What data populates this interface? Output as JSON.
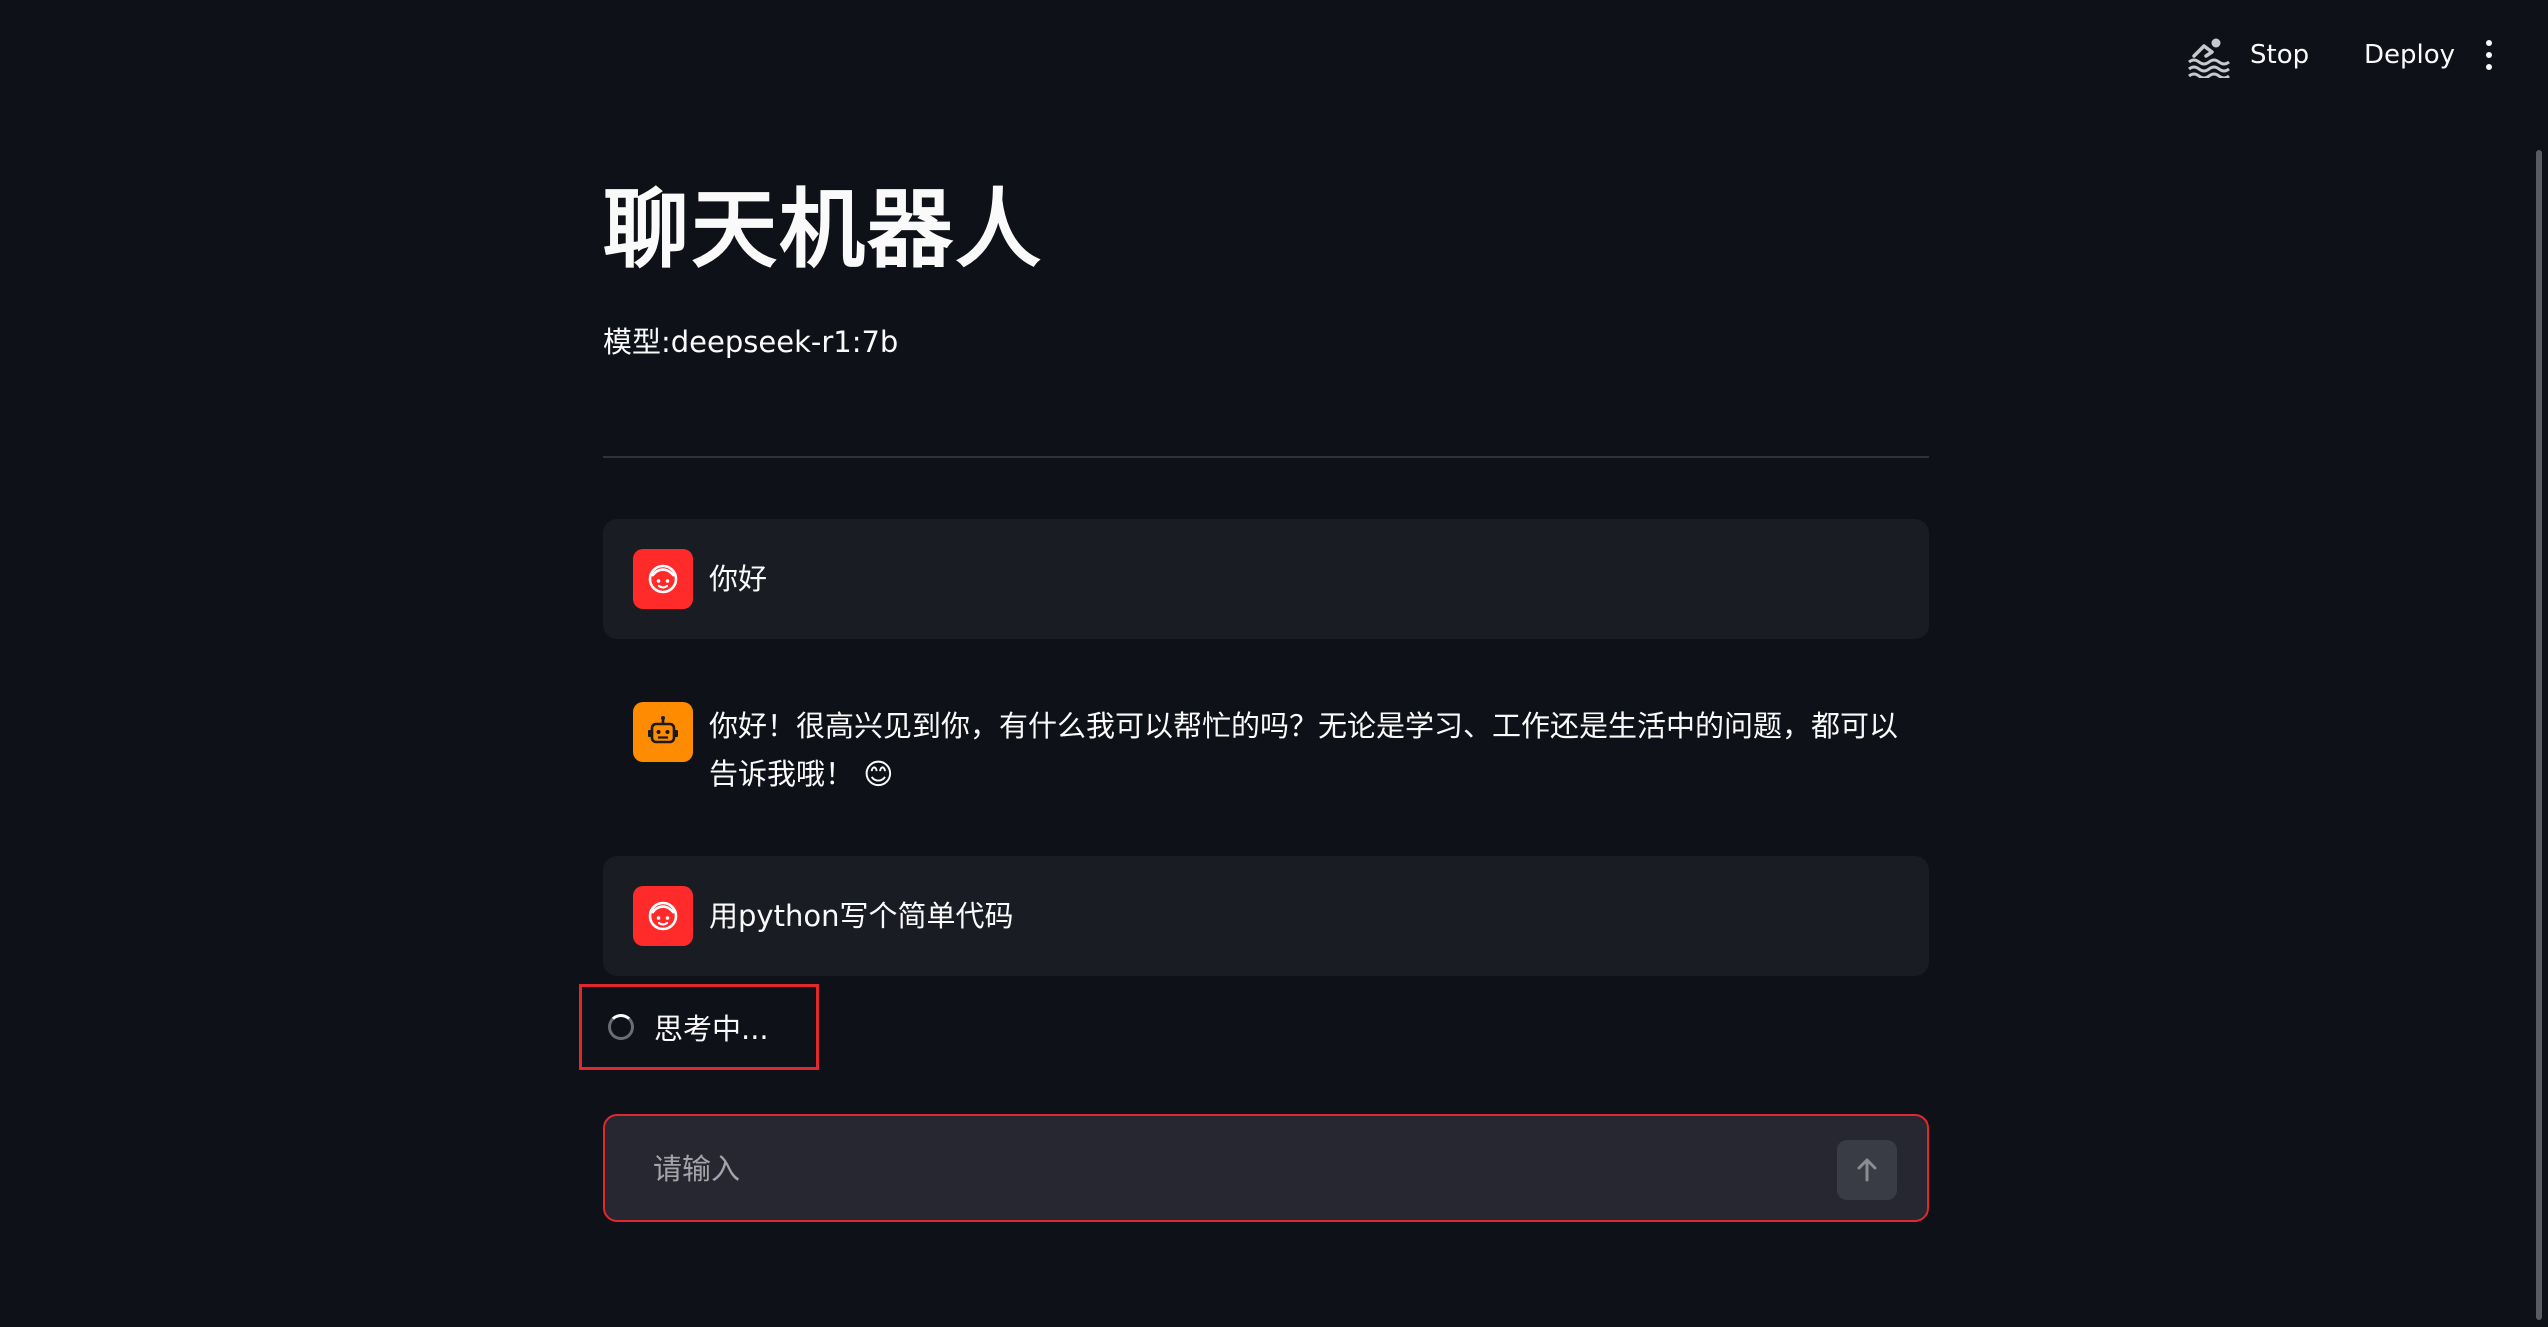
{
  "header": {
    "running_icon": "swimming-person-icon",
    "stop_label": "Stop",
    "deploy_label": "Deploy",
    "menu_icon": "vertical-ellipsis-icon"
  },
  "main": {
    "title": "聊天机器人",
    "model_line": "模型:deepseek-r1:7b"
  },
  "messages": [
    {
      "role": "user",
      "avatar_icon": "user-face-icon",
      "text": "你好"
    },
    {
      "role": "assistant",
      "avatar_icon": "robot-face-icon",
      "text": "你好！很高兴见到你，有什么我可以帮忙的吗？无论是学习、工作还是生活中的问题，都可以告诉我哦！ 😊"
    },
    {
      "role": "user",
      "avatar_icon": "user-face-icon",
      "text": "用python写个简单代码"
    }
  ],
  "status": {
    "spinner_icon": "loading-spinner-icon",
    "text": "思考中..."
  },
  "input": {
    "placeholder": "请输入",
    "value": "",
    "send_icon": "arrow-up-icon"
  },
  "colors": {
    "background": "#0e1117",
    "user_bubble": "#1a1c24",
    "user_avatar": "#ff2b2b",
    "bot_avatar": "#ff8c00",
    "highlight_border": "#e0282e",
    "input_bg": "#262730"
  }
}
